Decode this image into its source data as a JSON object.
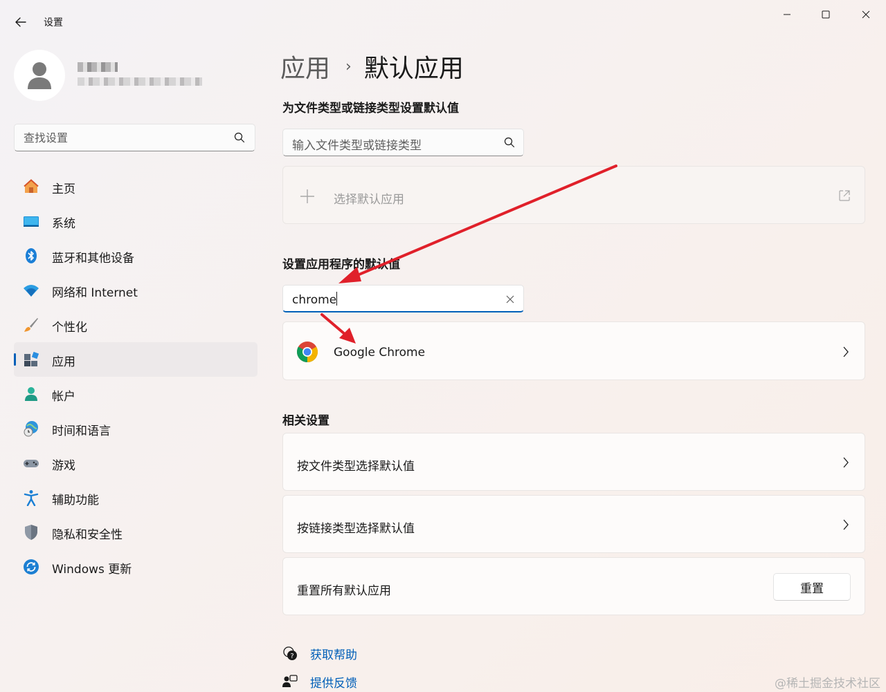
{
  "window": {
    "title": "设置",
    "minimize_icon": "minimize-icon",
    "maximize_icon": "maximize-icon",
    "close_icon": "close-icon"
  },
  "search": {
    "placeholder": "查找设置"
  },
  "sidebar": {
    "items": [
      {
        "label": "主页",
        "icon": "home-icon",
        "active": false
      },
      {
        "label": "系统",
        "icon": "system-icon",
        "active": false
      },
      {
        "label": "蓝牙和其他设备",
        "icon": "bluetooth-icon",
        "active": false
      },
      {
        "label": "网络和 Internet",
        "icon": "wifi-icon",
        "active": false
      },
      {
        "label": "个性化",
        "icon": "brush-icon",
        "active": false
      },
      {
        "label": "应用",
        "icon": "apps-icon",
        "active": true
      },
      {
        "label": "帐户",
        "icon": "account-icon",
        "active": false
      },
      {
        "label": "时间和语言",
        "icon": "time-language-icon",
        "active": false
      },
      {
        "label": "游戏",
        "icon": "gamepad-icon",
        "active": false
      },
      {
        "label": "辅助功能",
        "icon": "accessibility-icon",
        "active": false
      },
      {
        "label": "隐私和安全性",
        "icon": "shield-icon",
        "active": false
      },
      {
        "label": "Windows 更新",
        "icon": "update-icon",
        "active": false
      }
    ]
  },
  "breadcrumb": {
    "parent": "应用",
    "separator": "›",
    "current": "默认应用"
  },
  "file_types": {
    "title": "为文件类型或链接类型设置默认值",
    "search_placeholder": "输入文件类型或链接类型",
    "choose_default_label": "选择默认应用"
  },
  "app_defaults": {
    "title": "设置应用程序的默认值",
    "search_value": "chrome",
    "results": [
      {
        "name": "Google Chrome",
        "icon": "chrome-icon"
      }
    ]
  },
  "related": {
    "title": "相关设置",
    "by_file_type": "按文件类型选择默认值",
    "by_link_type": "按链接类型选择默认值",
    "reset_all": "重置所有默认应用",
    "reset_button": "重置"
  },
  "links": {
    "get_help": "获取帮助",
    "feedback": "提供反馈"
  },
  "watermark": "@稀土掘金技术社区",
  "colors": {
    "accent": "#005fb8",
    "annotation_arrow": "#e0202a"
  }
}
